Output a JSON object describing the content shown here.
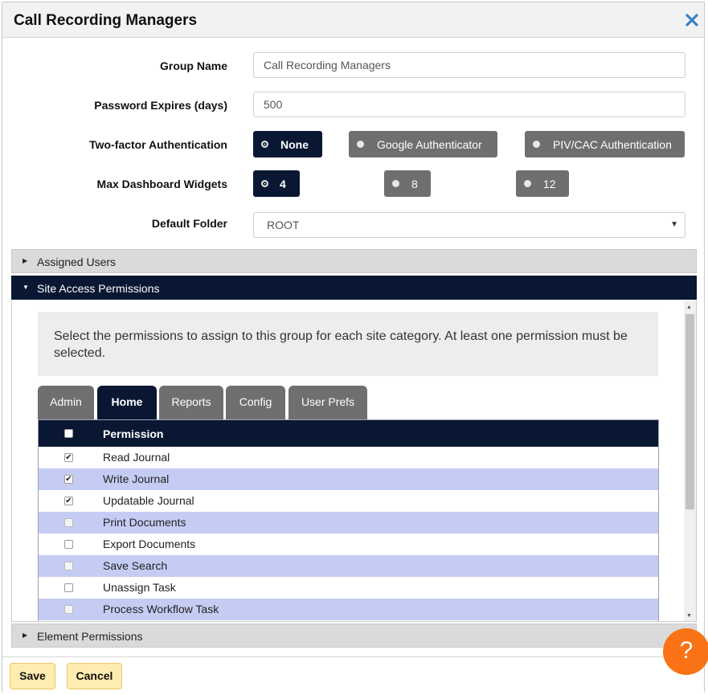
{
  "dialog": {
    "title": "Call Recording Managers",
    "close_icon": "close-icon"
  },
  "form": {
    "group_name": {
      "label": "Group Name",
      "value": "Call Recording Managers"
    },
    "password_expires": {
      "label": "Password Expires (days)",
      "value": "500"
    },
    "two_factor": {
      "label": "Two-factor Authentication",
      "options": [
        "None",
        "Google Authenticator",
        "PIV/CAC Authentication"
      ],
      "selected": "None"
    },
    "max_widgets": {
      "label": "Max Dashboard Widgets",
      "options": [
        "4",
        "8",
        "12"
      ],
      "selected": "4"
    },
    "default_folder": {
      "label": "Default Folder",
      "value": "ROOT"
    }
  },
  "accordion": {
    "assigned_users": "Assigned Users",
    "site_access": "Site Access Permissions",
    "element_permissions": "Element Permissions"
  },
  "site_access": {
    "info": "Select the permissions to assign to this group for each site category. At least one permission must be selected.",
    "tabs": [
      "Admin",
      "Home",
      "Reports",
      "Config",
      "User Prefs"
    ],
    "active_tab": "Home",
    "table_header": "Permission",
    "rows": [
      {
        "label": "Read Journal",
        "checked": true
      },
      {
        "label": "Write Journal",
        "checked": true
      },
      {
        "label": "Updatable Journal",
        "checked": true
      },
      {
        "label": "Print Documents",
        "checked": false
      },
      {
        "label": "Export Documents",
        "checked": false
      },
      {
        "label": "Save Search",
        "checked": false
      },
      {
        "label": "Unassign Task",
        "checked": false
      },
      {
        "label": "Process Workflow Task",
        "checked": false
      }
    ]
  },
  "footer": {
    "save": "Save",
    "cancel": "Cancel",
    "help": "?"
  },
  "colors": {
    "navy": "#0a1733",
    "gray_button": "#6f6f6f",
    "row_alt": "#c5ccf4",
    "footer_button": "#ffecb0",
    "help_button": "#f97316",
    "close_icon": "#3b82c4"
  }
}
